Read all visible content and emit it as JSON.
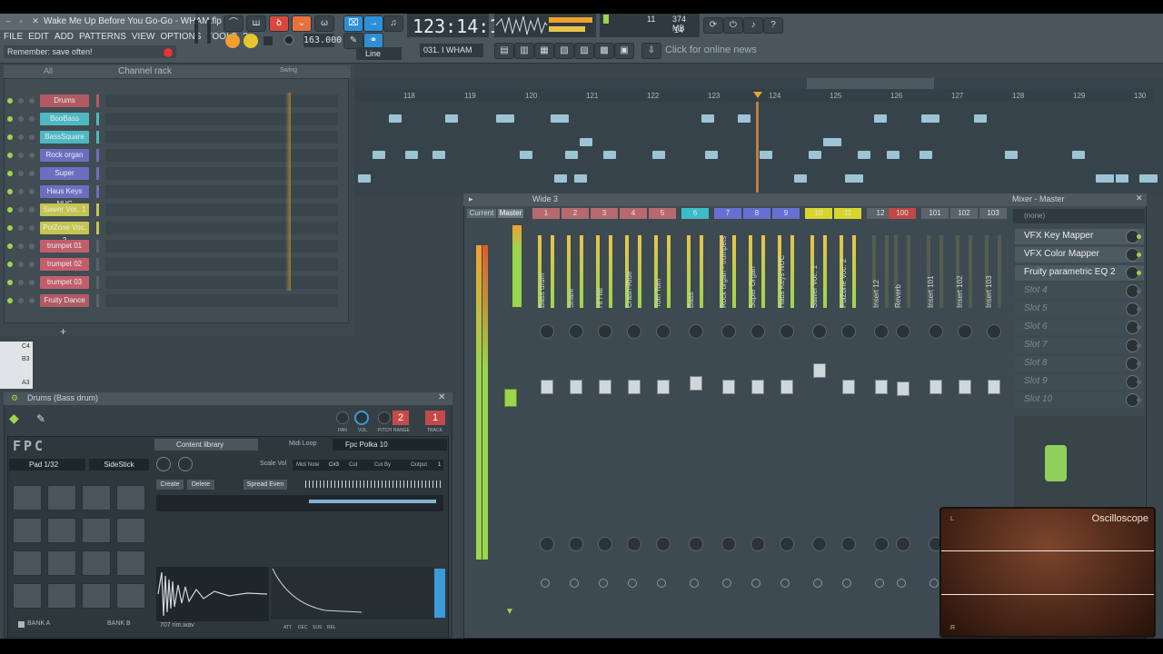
{
  "window": {
    "title": "Wake Me Up Before You Go-Go - WHAM.flp"
  },
  "menu": {
    "items": [
      "FILE",
      "EDIT",
      "ADD",
      "PATTERNS",
      "VIEW",
      "OPTIONS",
      "TOOLS",
      "?"
    ]
  },
  "hint": {
    "text": "Remember: save often!"
  },
  "transport": {
    "tempo": "163.000",
    "time": "123:14:15",
    "cpu_value": "11",
    "memory": "374 MB",
    "polyphony": "14"
  },
  "toolbar": {
    "pattern_label": "031. I WHAM",
    "snap_label": "Line",
    "news_text": "Click for online news"
  },
  "channel_rack": {
    "title": "Channel rack",
    "filter": "All",
    "swing_label": "Swing",
    "channels": [
      {
        "name": "Drums",
        "color": "#b15a63"
      },
      {
        "name": "BooBass",
        "color": "#4fb8c2"
      },
      {
        "name": "BassSquare",
        "color": "#4fb8c2"
      },
      {
        "name": "Rock organ",
        "color": "#6c6fc0"
      },
      {
        "name": "Super",
        "color": "#6c6fc0"
      },
      {
        "name": "Haus Keys NUC",
        "color": "#6c6fc0"
      },
      {
        "name": "Sawer Voc. 1",
        "color": "#c5c44f"
      },
      {
        "name": "PoiZone Voc. 2",
        "color": "#c5c44f"
      },
      {
        "name": "trumpet 01",
        "color": "#c25e6c"
      },
      {
        "name": "trumpet 02",
        "color": "#c25e6c"
      },
      {
        "name": "trumpet 03",
        "color": "#c25e6c"
      },
      {
        "name": "Fruity Dance",
        "color": "#b15a63"
      }
    ],
    "add_label": "+"
  },
  "piano_keys": [
    "C4",
    "B3",
    "A3"
  ],
  "playlist": {
    "bars": [
      "118",
      "119",
      "120",
      "121",
      "122",
      "123",
      "124",
      "125",
      "126",
      "127",
      "128",
      "129",
      "130"
    ]
  },
  "plugin": {
    "title": "Drums (Bass drum)",
    "logo": "FPC",
    "content_library": "Content library",
    "midi_loop_label": "Midi Loop",
    "preset": "Fpc Polka 10",
    "pad_label": "Pad 1/32",
    "pad_sound": "SideStick",
    "scale_vol": "Scale Vol",
    "midi_note_label": "Midi Note",
    "midi_note_value": "C#3",
    "cut_label": "Cut",
    "cut_by_label": "Cut By",
    "output_label": "Output",
    "output_value": "1",
    "create_label": "Create",
    "delete_label": "Delete",
    "spread_even_label": "Spread Even",
    "sample_name": "707 rim.wav",
    "bank_a": "BANK A",
    "bank_b": "BANK B",
    "knob_labels": [
      "PAN",
      "VOL",
      "PITCH",
      "RANGE",
      "TRACK"
    ],
    "range_value": "2",
    "track_value": "1",
    "env_labels": [
      "ATT",
      "DEC",
      "SUS",
      "REL"
    ]
  },
  "mixer": {
    "title": "Wide 3",
    "panel_title": "Mixer - Master",
    "current_label": "Current",
    "master_label": "Master",
    "slot_none": "(none)",
    "tracks": [
      {
        "num": "1",
        "name": "Bass drum",
        "color": "#b56a6e"
      },
      {
        "num": "2",
        "name": "Snare",
        "color": "#b56a6e"
      },
      {
        "num": "3",
        "name": "Hi Hat",
        "color": "#b56a6e"
      },
      {
        "num": "4",
        "name": "Crash-Ride",
        "color": "#b56a6e"
      },
      {
        "num": "5",
        "name": "Tom Tom",
        "color": "#b56a6e"
      },
      {
        "num": "6",
        "name": "Bass",
        "color": "#3cbcc8"
      },
      {
        "num": "7",
        "name": "Rock organ - trumpets",
        "color": "#6670d0"
      },
      {
        "num": "8",
        "name": "Super Organ",
        "color": "#6670d0"
      },
      {
        "num": "9",
        "name": "Haus Keys NUC",
        "color": "#6670d0"
      },
      {
        "num": "10",
        "name": "Sawer Voc. 1",
        "color": "#d8d62e"
      },
      {
        "num": "11",
        "name": "PoiZone Voc. 2",
        "color": "#d8d62e"
      },
      {
        "num": "12",
        "name": "Insert 12",
        "color": "#5a6469"
      },
      {
        "num": "100",
        "name": "Reverb",
        "color": "#c04848"
      },
      {
        "num": "101",
        "name": "Insert 101",
        "color": "#5a6469"
      },
      {
        "num": "102",
        "name": "Insert 102",
        "color": "#5a6469"
      },
      {
        "num": "103",
        "name": "Insert 103",
        "color": "#5a6469"
      }
    ],
    "fx_slots": [
      {
        "name": "VFX Key Mapper",
        "active": true
      },
      {
        "name": "VFX Color Mapper",
        "active": true
      },
      {
        "name": "Fruity parametric EQ 2",
        "active": true
      },
      {
        "name": "Slot 4",
        "active": false
      },
      {
        "name": "Slot 5",
        "active": false
      },
      {
        "name": "Slot 6",
        "active": false
      },
      {
        "name": "Slot 7",
        "active": false
      },
      {
        "name": "Slot 8",
        "active": false
      },
      {
        "name": "Slot 9",
        "active": false
      },
      {
        "name": "Slot 10",
        "active": false
      }
    ]
  },
  "oscilloscope": {
    "title": "Oscilloscope",
    "left_label": "L",
    "right_label": "R"
  },
  "colors": {
    "accent_orange": "#f0a030",
    "meter_green": "#9bd64c",
    "playhead": "#f0a030"
  }
}
